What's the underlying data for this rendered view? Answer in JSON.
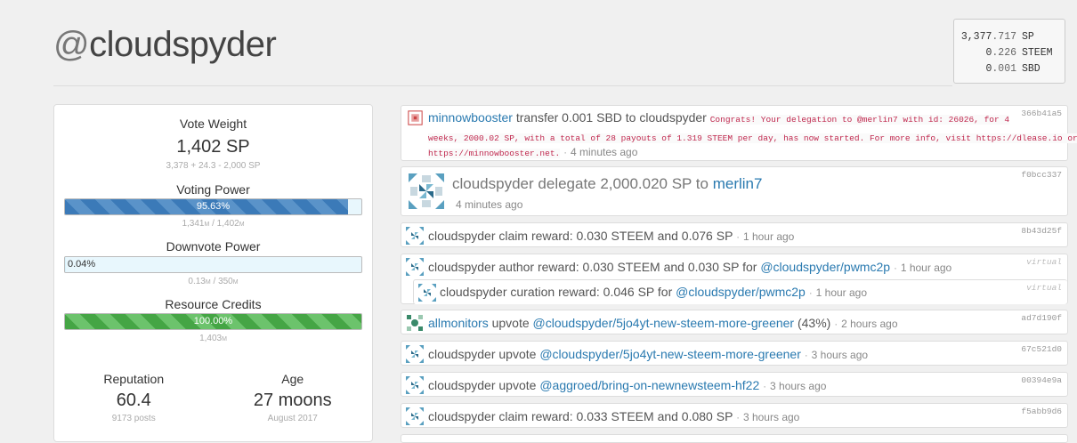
{
  "account": {
    "at": "@",
    "name": "cloudspyder"
  },
  "balances": [
    {
      "int": "3,377",
      "dec": ".717",
      "currency": "SP"
    },
    {
      "int": "0",
      "dec": ".226",
      "currency": "STEEM"
    },
    {
      "int": "0",
      "dec": ".001",
      "currency": "SBD"
    }
  ],
  "stats": {
    "vote_weight": {
      "label": "Vote Weight",
      "value": "1,402 SP",
      "detail": "3,378 + 24.3 - 2,000 SP"
    },
    "voting_power": {
      "label": "Voting Power",
      "text": "95.63%",
      "fraction": 0.9563,
      "detail_a": "1,341",
      "detail_b": "1,402",
      "unit": "M"
    },
    "downvote_power": {
      "label": "Downvote Power",
      "text": "0.04%",
      "fraction": 0.0004,
      "detail_a": "0.13",
      "detail_b": "350",
      "unit": "M"
    },
    "resource_credits": {
      "label": "Resource Credits",
      "text": "100.00%",
      "fraction": 1.0,
      "detail": "1,403",
      "unit": "M"
    },
    "reputation": {
      "label": "Reputation",
      "value": "60.4",
      "detail": "9173 posts"
    },
    "age": {
      "label": "Age",
      "value": "27 moons",
      "detail": "August 2017"
    }
  },
  "feed": [
    {
      "id": "366b41a5",
      "actor": "minnowbooster",
      "action": "transfer 0.001 SBD to cloudspyder",
      "memo_1": "Congrats! Your delegation to @merlin7 with id: 26026, for 4",
      "memo_2": "weeks, 2000.02 SP, with a total of 28 payouts of 1.319 STEEM per day, has now started. For more info, visit https://dlease.io or",
      "memo_3": "https://minnowbooster.net.",
      "time": "4 minutes ago"
    },
    {
      "id": "f0bcc337",
      "actor": "cloudspyder",
      "action": "delegate 2,000.020 SP to",
      "target": "merlin7",
      "time": "4 minutes ago"
    },
    {
      "id": "8b43d25f",
      "actor": "cloudspyder",
      "action": "claim reward: 0.030 STEEM and 0.076 SP",
      "time": "1 hour ago"
    },
    {
      "id": "virtual",
      "actor": "cloudspyder",
      "action": "author reward: 0.030 STEEM and 0.030 SP for",
      "target": "@cloudspyder/pwmc2p",
      "time": "1 hour ago"
    },
    {
      "id": "virtual",
      "actor": "cloudspyder",
      "action": "curation reward: 0.046 SP for",
      "target": "@cloudspyder/pwmc2p",
      "time": "1 hour ago"
    },
    {
      "id": "ad7d190f",
      "actor": "allmonitors",
      "action": "upvote",
      "target": "@cloudspyder/5jo4yt-new-steem-more-greener",
      "extra": "(43%)",
      "time": "2 hours ago"
    },
    {
      "id": "67c521d0",
      "actor": "cloudspyder",
      "action": "upvote",
      "target": "@cloudspyder/5jo4yt-new-steem-more-greener",
      "time": "3 hours ago"
    },
    {
      "id": "00394e9a",
      "actor": "cloudspyder",
      "action": "upvote",
      "target": "@aggroed/bring-on-newnewsteem-hf22",
      "time": "3 hours ago"
    },
    {
      "id": "f5abb9d6",
      "actor": "cloudspyder",
      "action": "claim reward: 0.033 STEEM and 0.080 SP",
      "time": "3 hours ago"
    }
  ]
}
